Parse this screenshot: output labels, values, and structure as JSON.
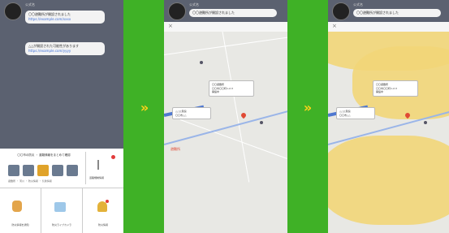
{
  "arrows": {
    "first": "»",
    "second": "»"
  },
  "screen1": {
    "sender": "公式名",
    "messages": [
      {
        "text": "〇〇避難所が開設されました",
        "link": "https://example.com/xxxx"
      },
      {
        "text": "△△が開設された可能性があります",
        "link": "https://example.com/yyyy"
      }
    ],
    "menu": {
      "top_title": "〇〇市の防災 ・ 避難情報をまとめて確認",
      "top_desc": "避難所 ・ 河川 ・ 防災情報 ・ 気象情報",
      "road_label": "道路規制情報",
      "cells": [
        {
          "label": "防災情報を通知"
        },
        {
          "label": "防災ライブカメラ"
        },
        {
          "label": "防災情報"
        }
      ]
    }
  },
  "screen2": {
    "sender": "公式名",
    "header_message": "〇〇避難所が開設されました",
    "popup_main": [
      "〇〇避難所",
      "〇〇市〇〇町1-2-3",
      "開設中"
    ],
    "popup_second": [
      "△△公民館",
      "〇〇市△△"
    ],
    "shelter_label": "避難所"
  },
  "screen3": {
    "sender": "公式名",
    "header_message": "〇〇避難所が開設されました",
    "popup_main": [
      "〇〇避難所",
      "〇〇市〇〇町1-2-3",
      "開設中"
    ],
    "popup_second": [
      "△△公民館",
      "〇〇市△△"
    ]
  },
  "colors": {
    "background": "#3fb126",
    "arrow": "#ffd21a",
    "hazard": "#f2d678",
    "route": "#4f78d0",
    "pin": "#e04a35"
  }
}
